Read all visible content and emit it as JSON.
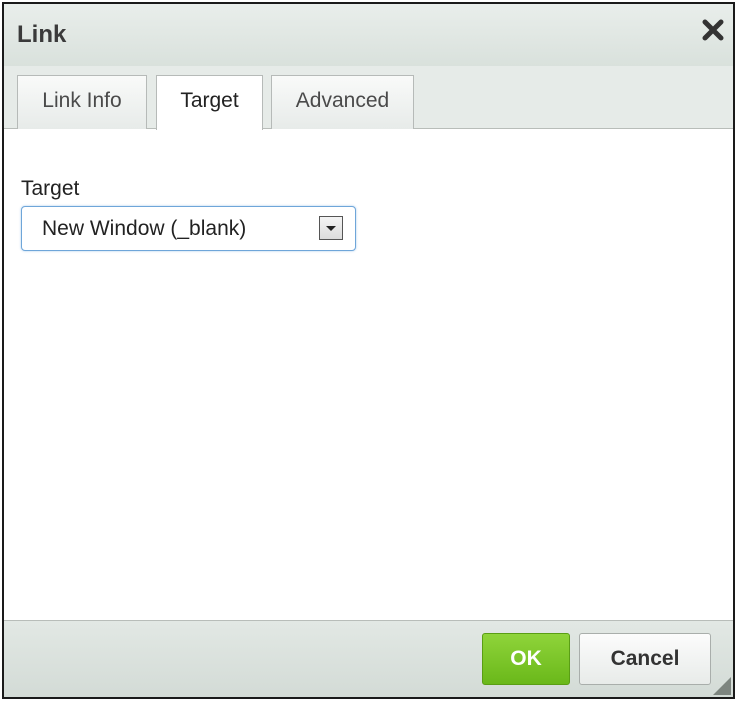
{
  "dialog": {
    "title": "Link"
  },
  "tabs": [
    {
      "label": "Link Info",
      "active": false
    },
    {
      "label": "Target",
      "active": true
    },
    {
      "label": "Advanced",
      "active": false
    }
  ],
  "target": {
    "label": "Target",
    "selected": "New Window (_blank)"
  },
  "buttons": {
    "ok": "OK",
    "cancel": "Cancel"
  },
  "colors": {
    "ok_button": "#6ab81a",
    "titlebar": "#e0e7e2",
    "select_focus_border": "#6fa6d9"
  },
  "icons": {
    "close": "close-icon",
    "dropdown": "chevron-down-icon",
    "resize": "resize-grip-icon"
  }
}
